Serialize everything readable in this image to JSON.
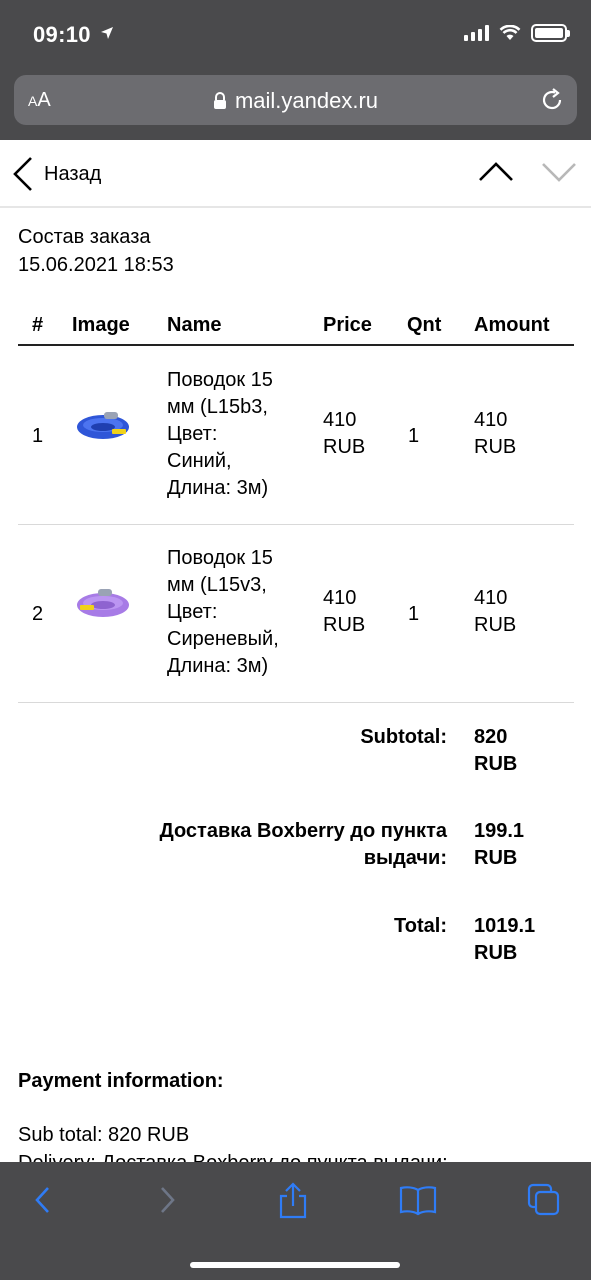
{
  "status_bar": {
    "time": "09:10"
  },
  "browser": {
    "aa_label": "AA",
    "url": "mail.yandex.ru"
  },
  "mail_nav": {
    "back_label": "Назад"
  },
  "order": {
    "title": "Состав заказа",
    "date": "15.06.2021 18:53",
    "columns": {
      "num": "#",
      "image": "Image",
      "name": "Name",
      "price": "Price",
      "qnt": "Qnt",
      "amount": "Amount"
    },
    "items": [
      {
        "num": "1",
        "name_lines": [
          "Поводок 15",
          "мм (L15b3,",
          "Цвет:",
          "Синий,",
          "Длина: 3м)"
        ],
        "price_lines": [
          "410",
          "RUB"
        ],
        "qnt": "1",
        "amount_lines": [
          "410",
          "RUB"
        ],
        "image_color": "#2f56d8"
      },
      {
        "num": "2",
        "name_lines": [
          "Поводок 15",
          "мм (L15v3,",
          "Цвет:",
          "Сиреневый,",
          "Длина: 3м)"
        ],
        "price_lines": [
          "410",
          "RUB"
        ],
        "qnt": "1",
        "amount_lines": [
          "410",
          "RUB"
        ],
        "image_color": "#a77be6"
      }
    ],
    "totals": {
      "subtotal_label": "Subtotal:",
      "subtotal_value_lines": [
        "820",
        "RUB"
      ],
      "delivery_label_lines": [
        "Доставка Boxberry до пункта",
        "выдачи:"
      ],
      "delivery_value_lines": [
        "199.1",
        "RUB"
      ],
      "total_label": "Total:",
      "total_value_lines": [
        "1019.1",
        "RUB"
      ]
    }
  },
  "payment": {
    "heading": "Payment information:",
    "sub_total": "Sub total: 820 RUB",
    "delivery": "Delivery: Доставка Boxberry до пункта выдачи:"
  },
  "colors": {
    "chrome": "#4a4a4c",
    "url_field": "#6c6c70",
    "toolbar_active": "#2f7cf6",
    "toolbar_disabled": "#6e7687"
  }
}
